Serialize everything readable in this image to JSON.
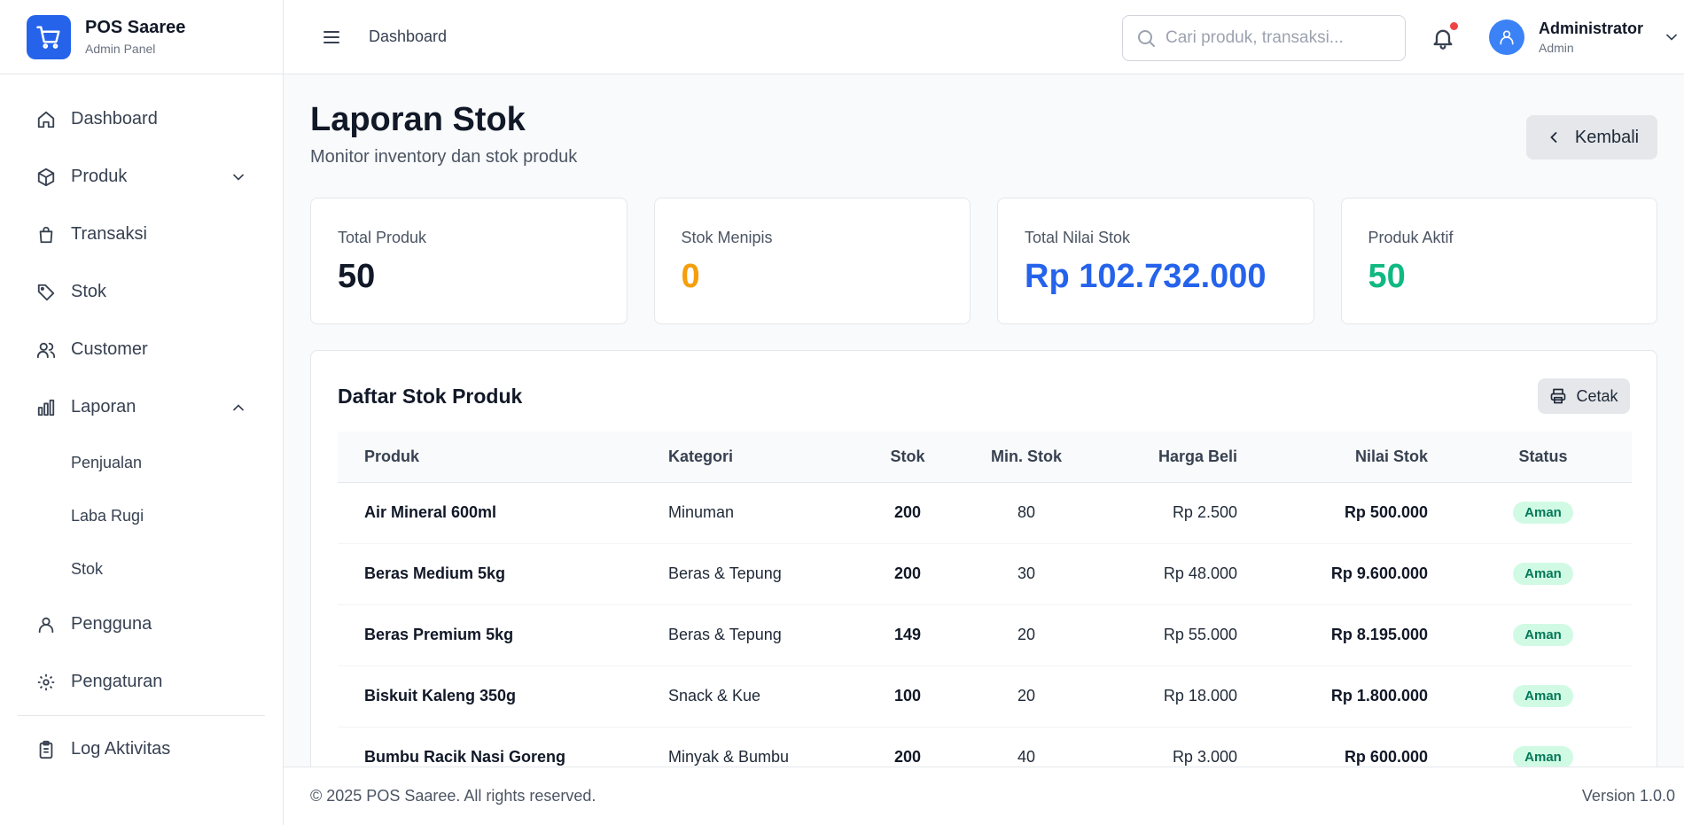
{
  "brand": {
    "name": "POS Saaree",
    "subtitle": "Admin Panel"
  },
  "header": {
    "title": "Dashboard",
    "search_placeholder": "Cari produk, transaksi...",
    "user": {
      "name": "Administrator",
      "role": "Admin"
    }
  },
  "sidebar": {
    "items": [
      {
        "label": "Dashboard",
        "icon": "home-icon"
      },
      {
        "label": "Produk",
        "icon": "box-icon",
        "expandable": true,
        "expanded": false
      },
      {
        "label": "Transaksi",
        "icon": "shopping-bag-icon"
      },
      {
        "label": "Stok",
        "icon": "tag-icon"
      },
      {
        "label": "Customer",
        "icon": "users-icon"
      },
      {
        "label": "Laporan",
        "icon": "bar-chart-icon",
        "expandable": true,
        "expanded": true
      },
      {
        "label": "Pengguna",
        "icon": "user-icon"
      },
      {
        "label": "Pengaturan",
        "icon": "gear-icon"
      },
      {
        "label": "Log Aktivitas",
        "icon": "clipboard-icon"
      }
    ],
    "laporan_sub": [
      "Penjualan",
      "Laba Rugi",
      "Stok"
    ]
  },
  "page": {
    "title": "Laporan Stok",
    "subtitle": "Monitor inventory dan stok produk",
    "back_label": "Kembali"
  },
  "stats": [
    {
      "label": "Total Produk",
      "value": "50",
      "color": "#111827"
    },
    {
      "label": "Stok Menipis",
      "value": "0",
      "color": "#f59e0b"
    },
    {
      "label": "Total Nilai Stok",
      "value": "Rp 102.732.000",
      "color": "#2563eb"
    },
    {
      "label": "Produk Aktif",
      "value": "50",
      "color": "#10b981"
    }
  ],
  "stock_table": {
    "title": "Daftar Stok Produk",
    "print_label": "Cetak",
    "columns": [
      "Produk",
      "Kategori",
      "Stok",
      "Min. Stok",
      "Harga Beli",
      "Nilai Stok",
      "Status"
    ],
    "rows": [
      {
        "produk": "Air Mineral 600ml",
        "kategori": "Minuman",
        "stok": "200",
        "min_stok": "80",
        "harga_beli": "Rp 2.500",
        "nilai_stok": "Rp 500.000",
        "status": "Aman"
      },
      {
        "produk": "Beras Medium 5kg",
        "kategori": "Beras & Tepung",
        "stok": "200",
        "min_stok": "30",
        "harga_beli": "Rp 48.000",
        "nilai_stok": "Rp 9.600.000",
        "status": "Aman"
      },
      {
        "produk": "Beras Premium 5kg",
        "kategori": "Beras & Tepung",
        "stok": "149",
        "min_stok": "20",
        "harga_beli": "Rp 55.000",
        "nilai_stok": "Rp 8.195.000",
        "status": "Aman"
      },
      {
        "produk": "Biskuit Kaleng 350g",
        "kategori": "Snack & Kue",
        "stok": "100",
        "min_stok": "20",
        "harga_beli": "Rp 18.000",
        "nilai_stok": "Rp 1.800.000",
        "status": "Aman"
      },
      {
        "produk": "Bumbu Racik Nasi Goreng",
        "kategori": "Minyak & Bumbu",
        "stok": "200",
        "min_stok": "40",
        "harga_beli": "Rp 3.000",
        "nilai_stok": "Rp 600.000",
        "status": "Aman"
      }
    ]
  },
  "footer": {
    "copyright": "© 2025 POS Saaree. All rights reserved.",
    "version": "Version 1.0.0"
  },
  "colors": {
    "accent": "#2563eb",
    "warning": "#f59e0b",
    "success": "#10b981",
    "badge_bg": "#d1fae5"
  }
}
